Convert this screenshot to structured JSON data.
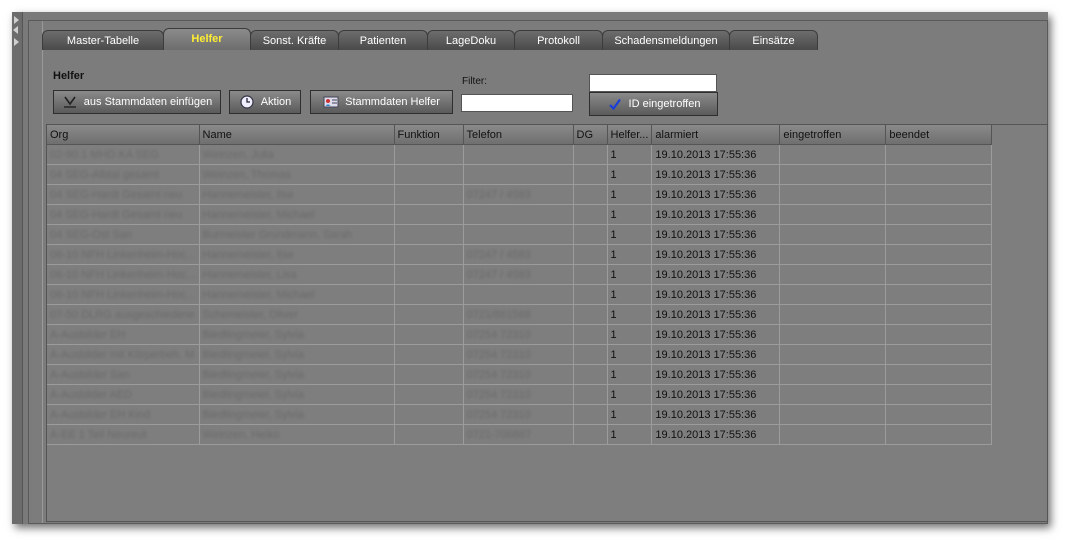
{
  "tabs": [
    {
      "label": "Master-Tabelle",
      "w": 122,
      "active": false
    },
    {
      "label": "Helfer",
      "w": 88,
      "active": true
    },
    {
      "label": "Sonst. Kräfte",
      "w": 89,
      "active": false
    },
    {
      "label": "Patienten",
      "w": 90,
      "active": false
    },
    {
      "label": "LageDoku",
      "w": 88,
      "active": false
    },
    {
      "label": "Protokoll",
      "w": 89,
      "active": false
    },
    {
      "label": "Schadensmeldungen",
      "w": 128,
      "active": false
    },
    {
      "label": "Einsätze",
      "w": 89,
      "active": false
    }
  ],
  "section_title": "Helfer",
  "toolbar": {
    "import_label": "aus Stammdaten einfügen",
    "action_label": "Aktion",
    "masterdata_label": "Stammdaten Helfer",
    "filter_label": "Filter:",
    "filter_value": "",
    "id_value": "",
    "id_arrived_label": "ID eingetroffen"
  },
  "icons": {
    "import": "import-arrow-icon",
    "action": "clock-icon",
    "masterdata": "person-card-icon",
    "id_arrived": "checkmark-icon"
  },
  "colors": {
    "active_tab": "#ffee33",
    "checkmark": "#1a3fd8"
  },
  "table": {
    "columns": [
      "Org",
      "Name",
      "Funktion",
      "Telefon",
      "DG",
      "Helfer...",
      "alarmiert",
      "eingetroffen",
      "beendet"
    ],
    "rows": [
      [
        "02-90.1 MHD KA SEG",
        "Weinzen, Julia",
        "",
        "",
        "",
        "1",
        "19.10.2013 17:55:36",
        "",
        ""
      ],
      [
        "04 SEG-Albtal gesamt",
        "Weinzen, Thomas",
        "",
        "",
        "",
        "1",
        "19.10.2013 17:55:36",
        "",
        ""
      ],
      [
        "04 SEG-Hardt Gesamt neu",
        "Hannemeister, Ilse",
        "",
        "07247 / 4583",
        "",
        "1",
        "19.10.2013 17:55:36",
        "",
        ""
      ],
      [
        "04 SEG-Hardt Gesamt neu",
        "Hannemeister, Michael",
        "",
        "",
        "",
        "1",
        "19.10.2013 17:55:36",
        "",
        ""
      ],
      [
        "04 SEG-Ost San",
        "Burmeister Grundmann, Sarah",
        "",
        "",
        "",
        "1",
        "19.10.2013 17:55:36",
        "",
        ""
      ],
      [
        "06-10 NFH Linkenheim-Hoc...",
        "Hannemeister, Ilse",
        "",
        "07247 / 4583",
        "",
        "1",
        "19.10.2013 17:55:36",
        "",
        ""
      ],
      [
        "06-10 NFH Linkenheim-Hoc...",
        "Hannemeister, Lisa",
        "",
        "07247 / 4583",
        "",
        "1",
        "19.10.2013 17:55:36",
        "",
        ""
      ],
      [
        "06-10 NFH Linkenheim-Hoc...",
        "Hannemeister, Michael",
        "",
        "",
        "",
        "1",
        "19.10.2013 17:55:36",
        "",
        ""
      ],
      [
        "07-50 DLRG ausgeschiedene",
        "Schemeister, Oliver",
        "",
        "0721/861568",
        "",
        "1",
        "19.10.2013 17:55:36",
        "",
        ""
      ],
      [
        "A-Ausbilder EH",
        "Biedlingmeier, Sylvia",
        "",
        "07254 72310",
        "",
        "1",
        "19.10.2013 17:55:36",
        "",
        ""
      ],
      [
        "A-Ausbilder mit Körperbeh. M",
        "Biedlingmeier, Sylvia",
        "",
        "07254 72310",
        "",
        "1",
        "19.10.2013 17:55:36",
        "",
        ""
      ],
      [
        "A-Ausbilder San",
        "Biedlingmeier, Sylvia",
        "",
        "07254 72310",
        "",
        "1",
        "19.10.2013 17:55:36",
        "",
        ""
      ],
      [
        "A-Ausbilder AED",
        "Biedlingmeier, Sylvia",
        "",
        "07254 72310",
        "",
        "1",
        "19.10.2013 17:55:36",
        "",
        ""
      ],
      [
        "A-Ausbilder EH Kind",
        "Biedlingmeier, Sylvia",
        "",
        "07254 72310",
        "",
        "1",
        "19.10.2013 17:55:36",
        "",
        ""
      ],
      [
        "A-EE 1 Teil Neureut",
        "Weinzen, Heiko",
        "",
        "0721-706867",
        "",
        "1",
        "19.10.2013 17:55:36",
        "",
        ""
      ]
    ]
  }
}
